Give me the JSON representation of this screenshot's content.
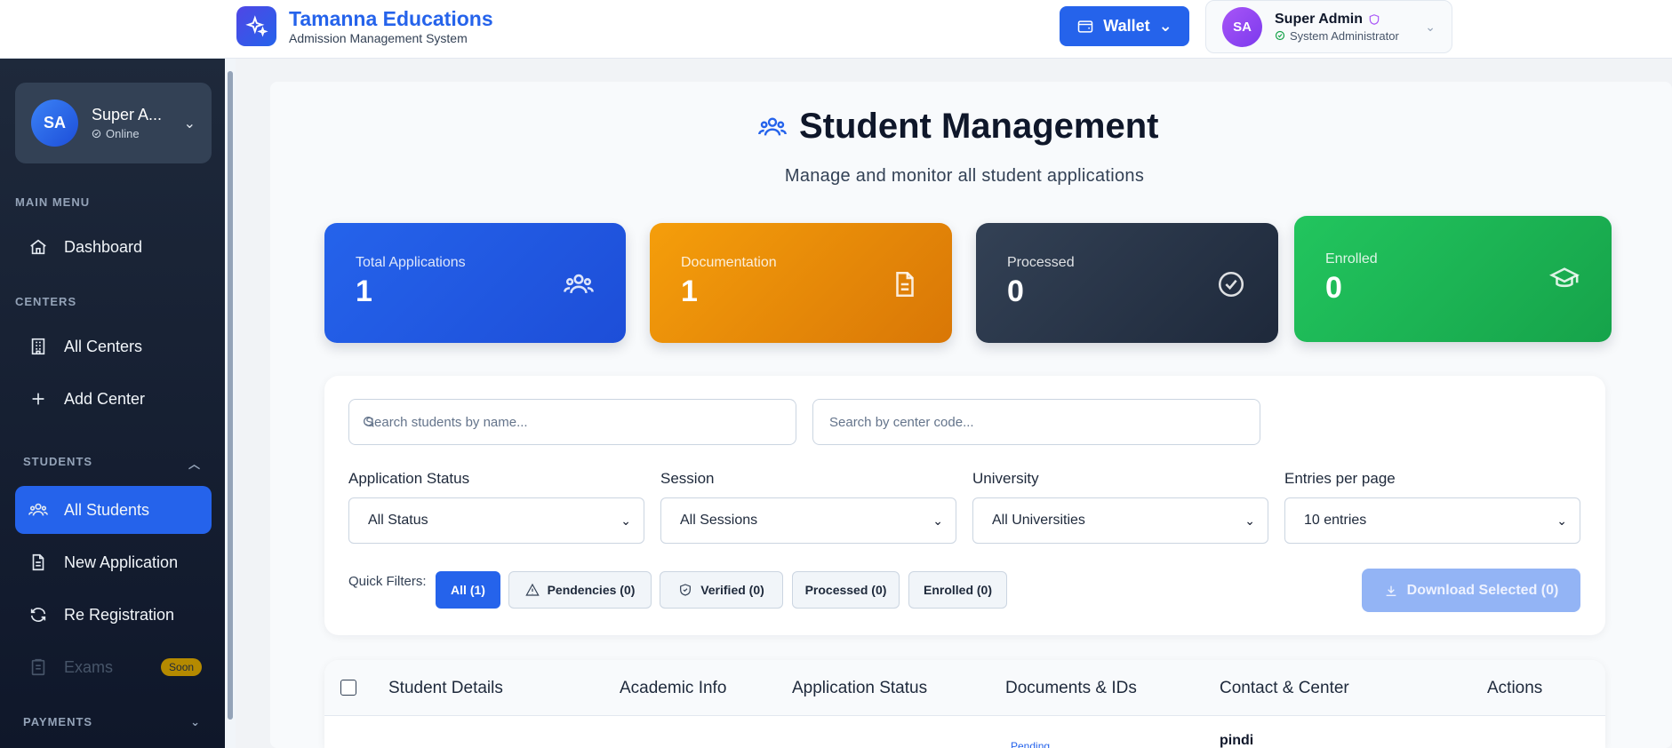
{
  "header": {
    "brand_title": "Tamanna Educations",
    "brand_subtitle": "Admission Management System",
    "wallet_label": "Wallet",
    "profile_name": "Super Admin",
    "profile_role": "System Administrator",
    "profile_initials": "SA"
  },
  "sidebar": {
    "user_initials": "SA",
    "user_name": "Super A...",
    "user_status": "Online",
    "sections": {
      "main": "MAIN MENU",
      "centers": "CENTERS",
      "students": "STUDENTS",
      "payments": "PAYMENTS"
    },
    "items": {
      "dashboard": "Dashboard",
      "all_centers": "All Centers",
      "add_center": "Add Center",
      "all_students": "All Students",
      "new_application": "New Application",
      "re_registration": "Re Registration",
      "exams": "Exams",
      "exams_badge": "Soon"
    }
  },
  "page": {
    "title": "Student Management",
    "subtitle": "Manage and monitor all student applications"
  },
  "stats": [
    {
      "label": "Total Applications",
      "value": "1",
      "color": "#2563eb",
      "icon": "users-icon"
    },
    {
      "label": "Documentation",
      "value": "1",
      "color": "#f59e0b",
      "icon": "document-icon"
    },
    {
      "label": "Processed",
      "value": "0",
      "color": "#1e293b",
      "icon": "check-circle-icon"
    },
    {
      "label": "Enrolled",
      "value": "0",
      "color": "#16a34a",
      "icon": "graduation-cap-icon"
    }
  ],
  "filters": {
    "search_name_placeholder": "Search students by name...",
    "search_center_placeholder": "Search by center code...",
    "status_label": "Application Status",
    "status_value": "All Status",
    "session_label": "Session",
    "session_value": "All Sessions",
    "university_label": "University",
    "university_value": "All Universities",
    "entries_label": "Entries per page",
    "entries_value": "10 entries",
    "quick_filters_label": "Quick Filters:",
    "chips": {
      "all": "All (1)",
      "pendencies": "Pendencies (0)",
      "verified": "Verified (0)",
      "processed": "Processed (0)",
      "enrolled": "Enrolled (0)"
    },
    "download_label": "Download Selected (0)"
  },
  "table": {
    "columns": [
      "Student Details",
      "Academic Info",
      "Application Status",
      "Documents & IDs",
      "Contact & Center",
      "Actions"
    ],
    "row_partial": {
      "documents": "Pending",
      "contact": "pindi"
    }
  }
}
